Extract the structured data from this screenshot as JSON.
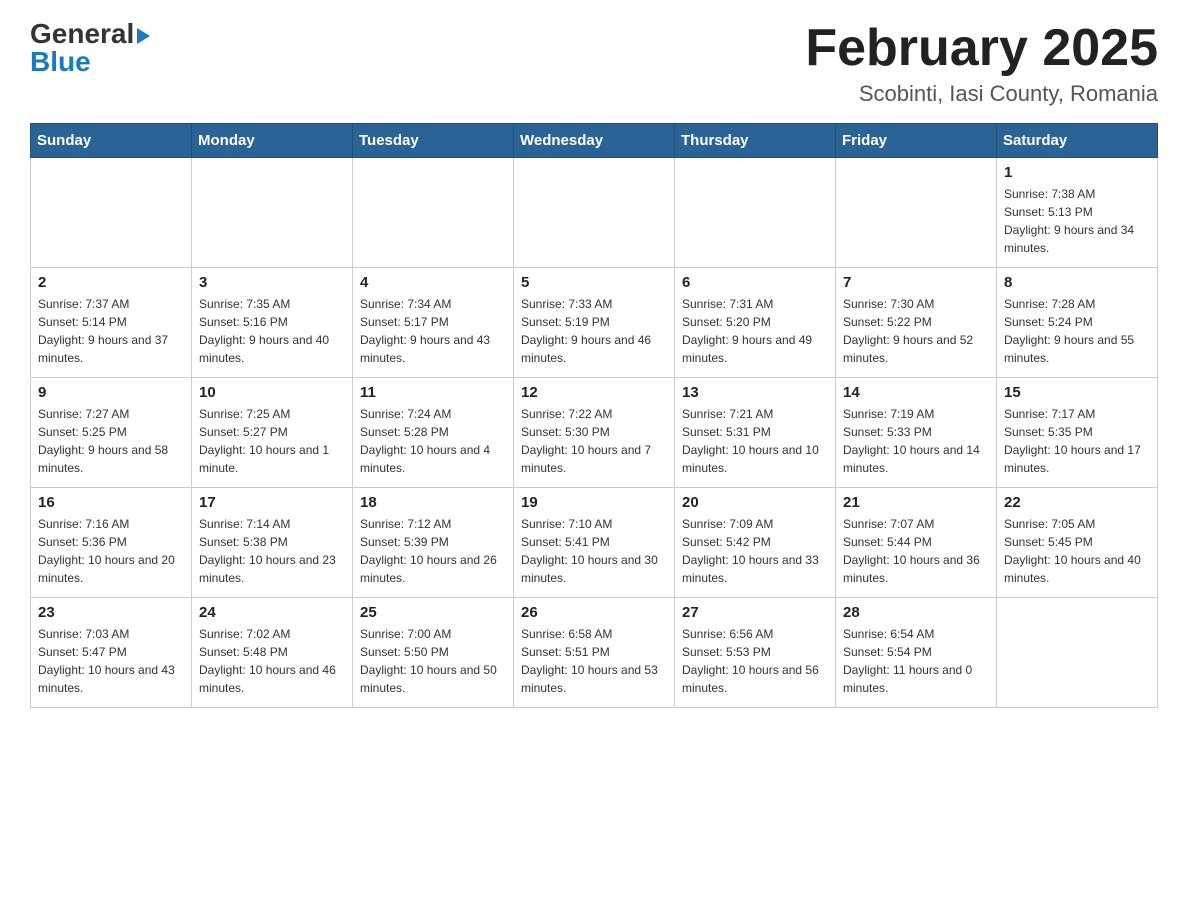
{
  "header": {
    "logo_general": "General",
    "logo_blue": "Blue",
    "title": "February 2025",
    "location": "Scobinti, Iasi County, Romania"
  },
  "days_of_week": [
    "Sunday",
    "Monday",
    "Tuesday",
    "Wednesday",
    "Thursday",
    "Friday",
    "Saturday"
  ],
  "weeks": [
    [
      {
        "day": "",
        "info": ""
      },
      {
        "day": "",
        "info": ""
      },
      {
        "day": "",
        "info": ""
      },
      {
        "day": "",
        "info": ""
      },
      {
        "day": "",
        "info": ""
      },
      {
        "day": "",
        "info": ""
      },
      {
        "day": "1",
        "info": "Sunrise: 7:38 AM\nSunset: 5:13 PM\nDaylight: 9 hours and 34 minutes."
      }
    ],
    [
      {
        "day": "2",
        "info": "Sunrise: 7:37 AM\nSunset: 5:14 PM\nDaylight: 9 hours and 37 minutes."
      },
      {
        "day": "3",
        "info": "Sunrise: 7:35 AM\nSunset: 5:16 PM\nDaylight: 9 hours and 40 minutes."
      },
      {
        "day": "4",
        "info": "Sunrise: 7:34 AM\nSunset: 5:17 PM\nDaylight: 9 hours and 43 minutes."
      },
      {
        "day": "5",
        "info": "Sunrise: 7:33 AM\nSunset: 5:19 PM\nDaylight: 9 hours and 46 minutes."
      },
      {
        "day": "6",
        "info": "Sunrise: 7:31 AM\nSunset: 5:20 PM\nDaylight: 9 hours and 49 minutes."
      },
      {
        "day": "7",
        "info": "Sunrise: 7:30 AM\nSunset: 5:22 PM\nDaylight: 9 hours and 52 minutes."
      },
      {
        "day": "8",
        "info": "Sunrise: 7:28 AM\nSunset: 5:24 PM\nDaylight: 9 hours and 55 minutes."
      }
    ],
    [
      {
        "day": "9",
        "info": "Sunrise: 7:27 AM\nSunset: 5:25 PM\nDaylight: 9 hours and 58 minutes."
      },
      {
        "day": "10",
        "info": "Sunrise: 7:25 AM\nSunset: 5:27 PM\nDaylight: 10 hours and 1 minute."
      },
      {
        "day": "11",
        "info": "Sunrise: 7:24 AM\nSunset: 5:28 PM\nDaylight: 10 hours and 4 minutes."
      },
      {
        "day": "12",
        "info": "Sunrise: 7:22 AM\nSunset: 5:30 PM\nDaylight: 10 hours and 7 minutes."
      },
      {
        "day": "13",
        "info": "Sunrise: 7:21 AM\nSunset: 5:31 PM\nDaylight: 10 hours and 10 minutes."
      },
      {
        "day": "14",
        "info": "Sunrise: 7:19 AM\nSunset: 5:33 PM\nDaylight: 10 hours and 14 minutes."
      },
      {
        "day": "15",
        "info": "Sunrise: 7:17 AM\nSunset: 5:35 PM\nDaylight: 10 hours and 17 minutes."
      }
    ],
    [
      {
        "day": "16",
        "info": "Sunrise: 7:16 AM\nSunset: 5:36 PM\nDaylight: 10 hours and 20 minutes."
      },
      {
        "day": "17",
        "info": "Sunrise: 7:14 AM\nSunset: 5:38 PM\nDaylight: 10 hours and 23 minutes."
      },
      {
        "day": "18",
        "info": "Sunrise: 7:12 AM\nSunset: 5:39 PM\nDaylight: 10 hours and 26 minutes."
      },
      {
        "day": "19",
        "info": "Sunrise: 7:10 AM\nSunset: 5:41 PM\nDaylight: 10 hours and 30 minutes."
      },
      {
        "day": "20",
        "info": "Sunrise: 7:09 AM\nSunset: 5:42 PM\nDaylight: 10 hours and 33 minutes."
      },
      {
        "day": "21",
        "info": "Sunrise: 7:07 AM\nSunset: 5:44 PM\nDaylight: 10 hours and 36 minutes."
      },
      {
        "day": "22",
        "info": "Sunrise: 7:05 AM\nSunset: 5:45 PM\nDaylight: 10 hours and 40 minutes."
      }
    ],
    [
      {
        "day": "23",
        "info": "Sunrise: 7:03 AM\nSunset: 5:47 PM\nDaylight: 10 hours and 43 minutes."
      },
      {
        "day": "24",
        "info": "Sunrise: 7:02 AM\nSunset: 5:48 PM\nDaylight: 10 hours and 46 minutes."
      },
      {
        "day": "25",
        "info": "Sunrise: 7:00 AM\nSunset: 5:50 PM\nDaylight: 10 hours and 50 minutes."
      },
      {
        "day": "26",
        "info": "Sunrise: 6:58 AM\nSunset: 5:51 PM\nDaylight: 10 hours and 53 minutes."
      },
      {
        "day": "27",
        "info": "Sunrise: 6:56 AM\nSunset: 5:53 PM\nDaylight: 10 hours and 56 minutes."
      },
      {
        "day": "28",
        "info": "Sunrise: 6:54 AM\nSunset: 5:54 PM\nDaylight: 11 hours and 0 minutes."
      },
      {
        "day": "",
        "info": ""
      }
    ]
  ]
}
